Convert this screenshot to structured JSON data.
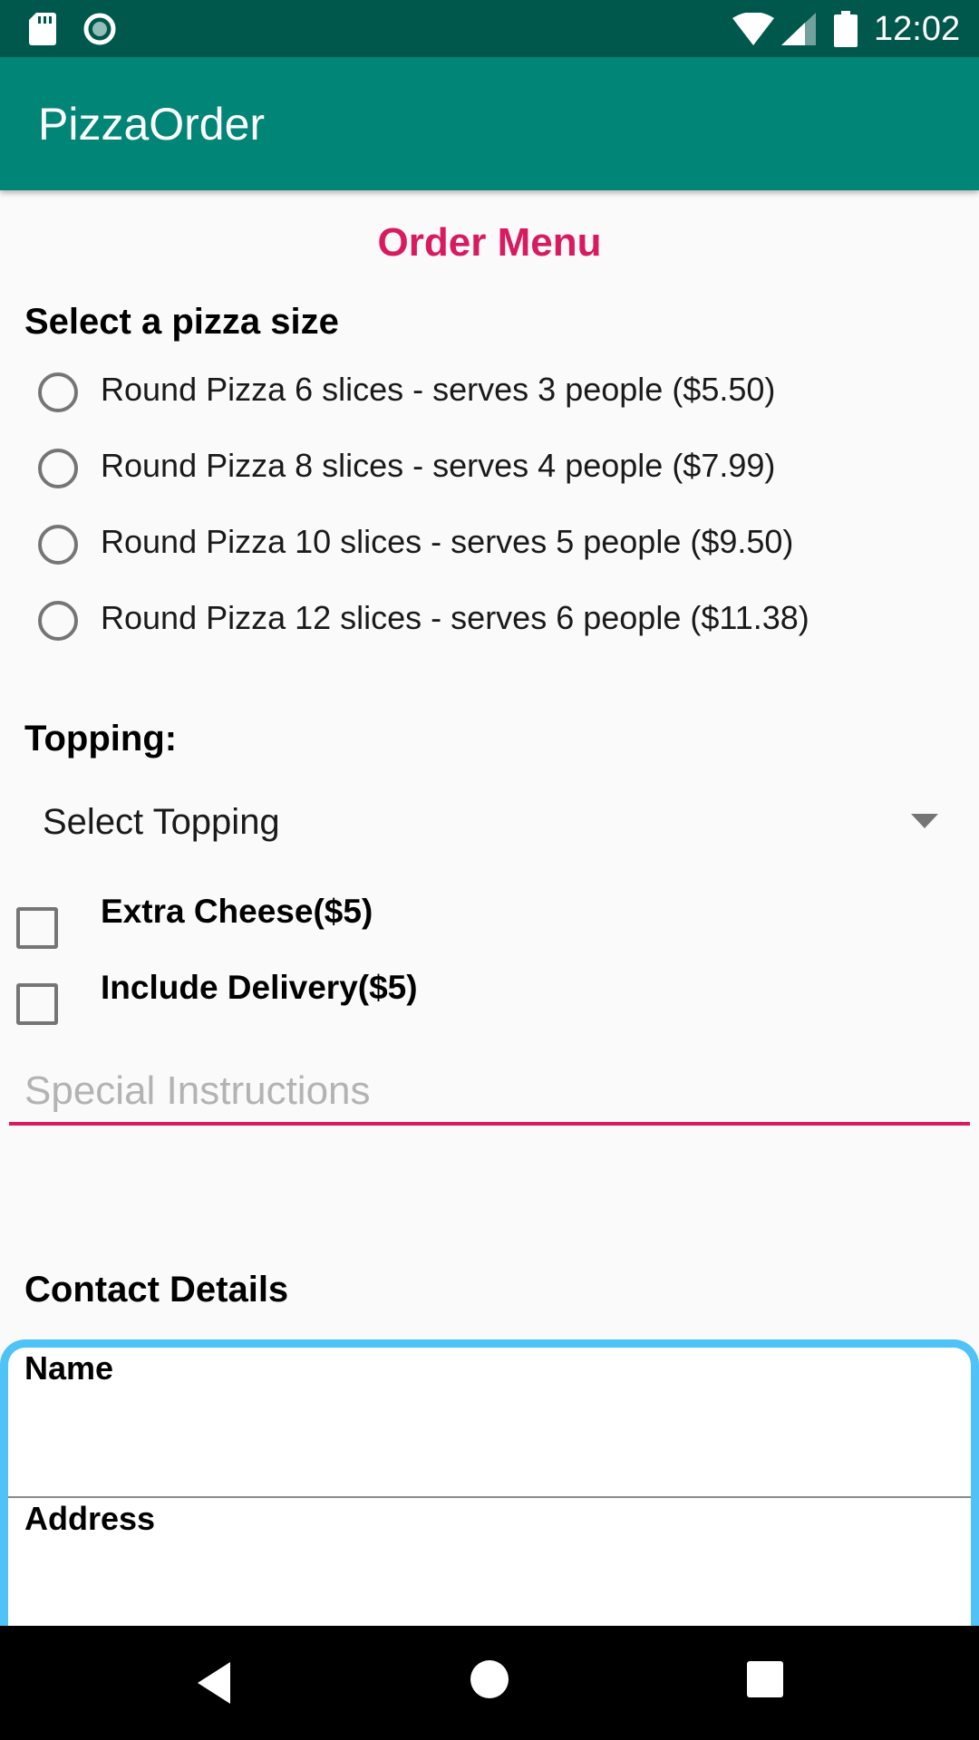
{
  "status_bar": {
    "time": "12:02",
    "icons": [
      "sd-card-icon",
      "sync-icon",
      "wifi-icon",
      "signal-icon",
      "battery-icon"
    ]
  },
  "app_bar": {
    "title": "PizzaOrder"
  },
  "order": {
    "heading": "Order Menu",
    "size_label": "Select a pizza size",
    "sizes": [
      "Round Pizza 6 slices - serves 3 people ($5.50)",
      "Round Pizza 8 slices - serves 4 people ($7.99)",
      "Round Pizza 10 slices - serves 5 people ($9.50)",
      "Round Pizza 12 slices - serves 6 people ($11.38)"
    ],
    "topping_label": "Topping:",
    "topping_selected": "Select Topping",
    "extras": [
      {
        "label": "Extra Cheese($5)",
        "checked": false
      },
      {
        "label": "Include Delivery($5)",
        "checked": false
      }
    ],
    "instructions_placeholder": "Special Instructions",
    "instructions_value": ""
  },
  "contact": {
    "heading": "Contact Details",
    "name_label": "Name",
    "address_label": "Address"
  },
  "colors": {
    "status_bar": "#00574b",
    "app_bar": "#008577",
    "accent": "#d81b60",
    "card_border": "#4fc3f7"
  },
  "nav_bar": {
    "icons": [
      "back-icon",
      "home-icon",
      "recents-icon"
    ]
  }
}
